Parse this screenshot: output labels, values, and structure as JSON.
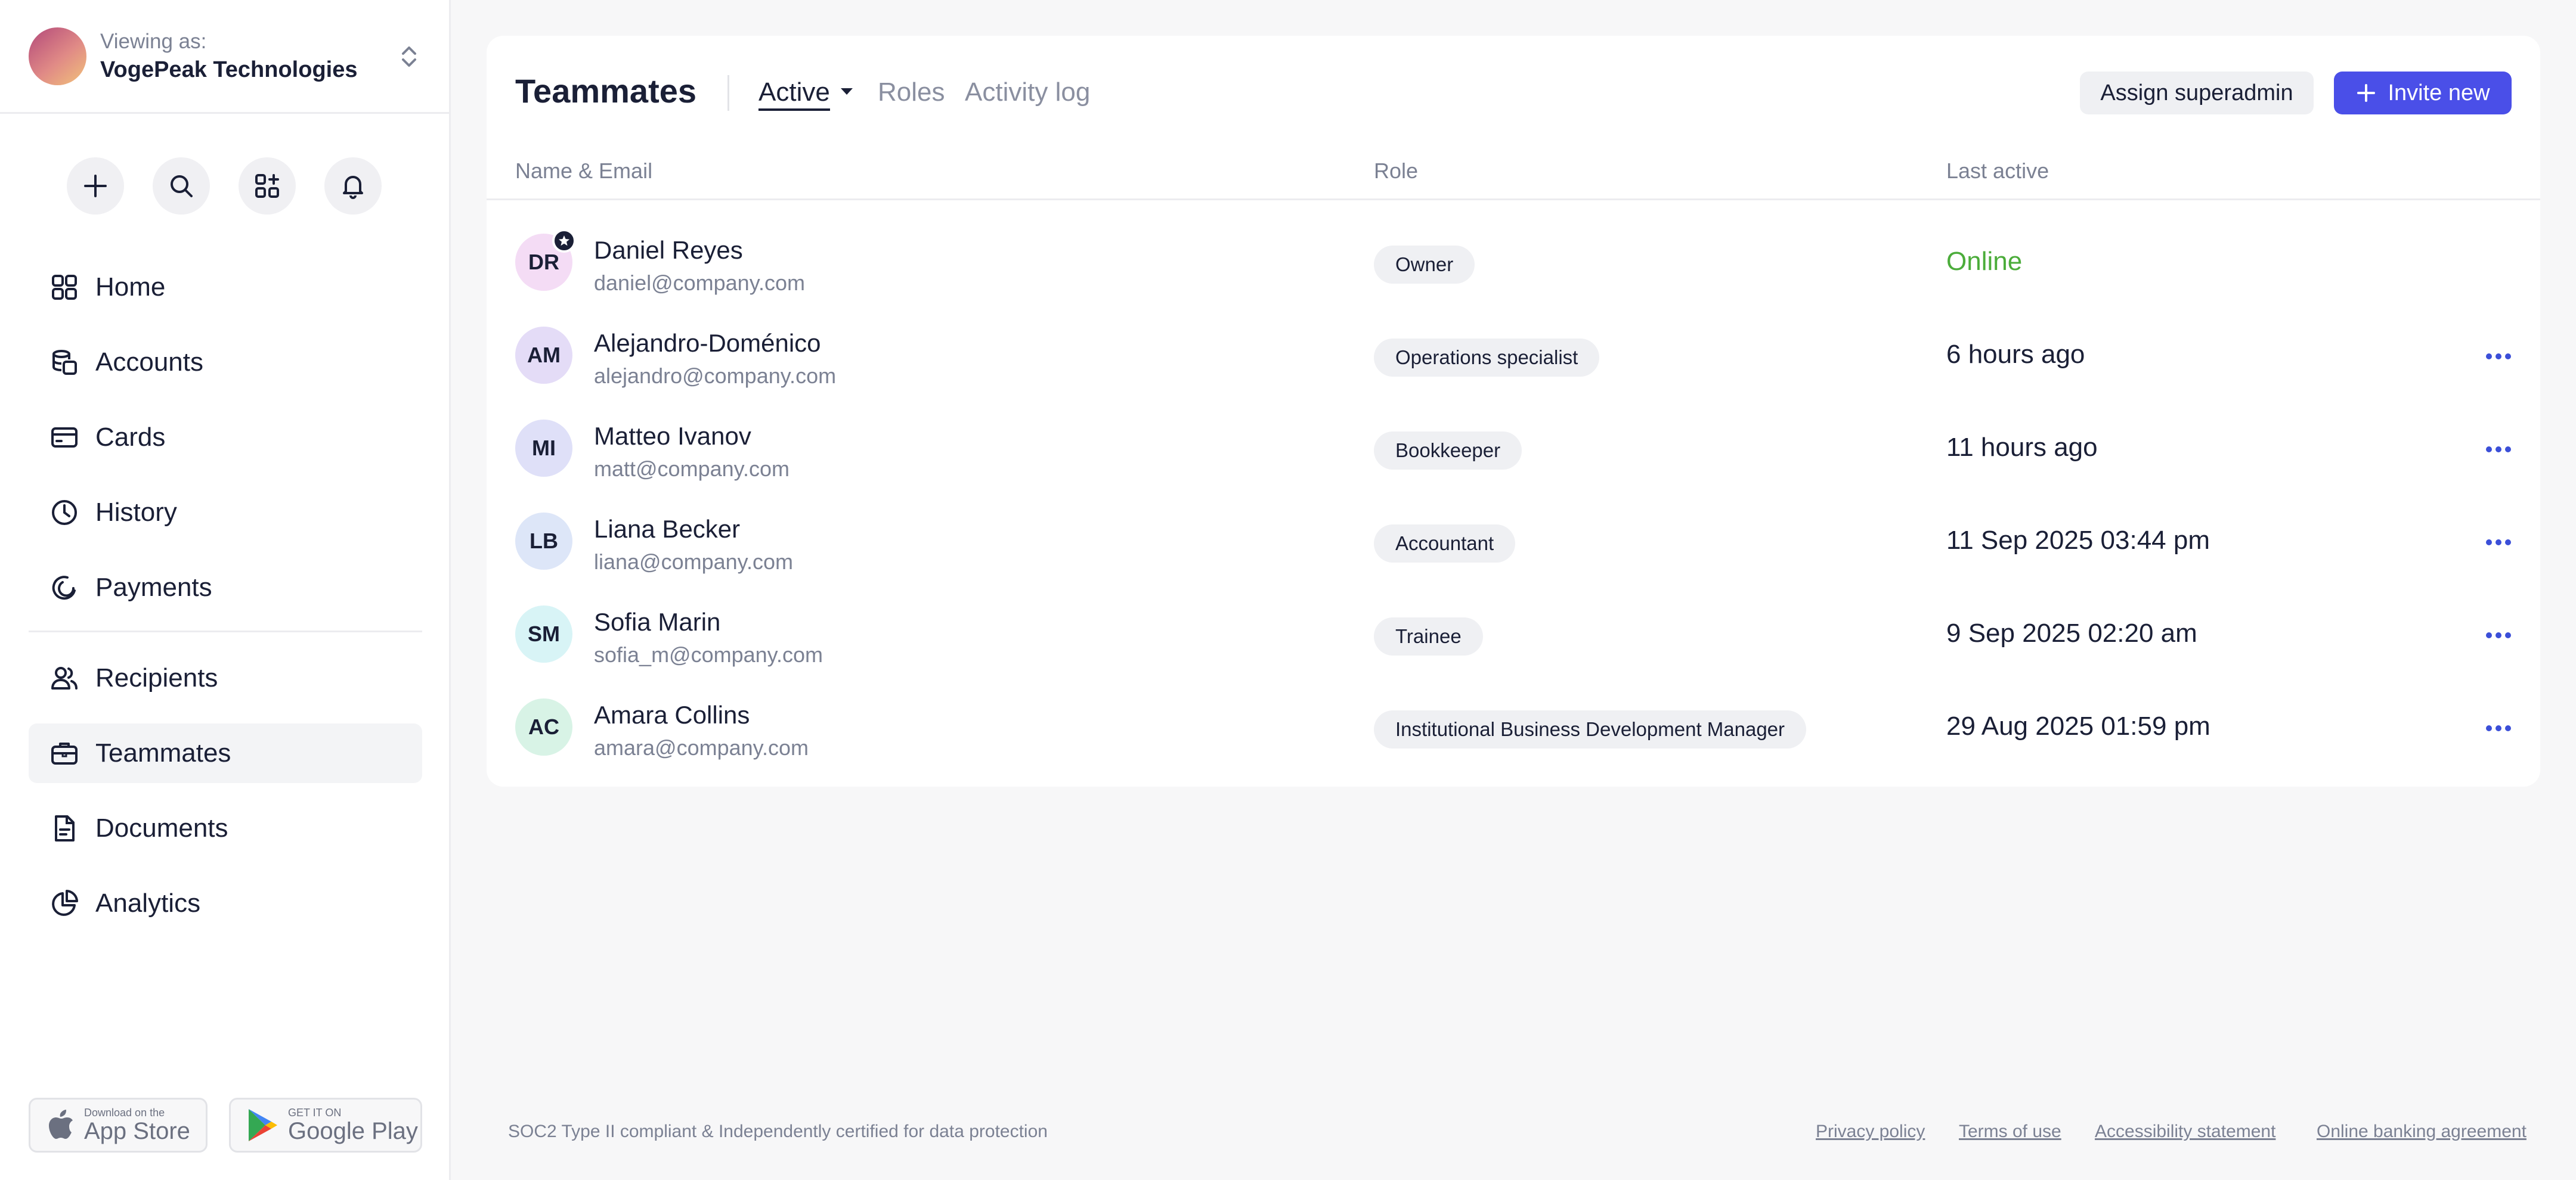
{
  "account": {
    "viewing_label": "Viewing as:",
    "company": "VogePeak Technologies"
  },
  "quick_actions": [
    "add-icon",
    "search-icon",
    "apps-icon",
    "bell-icon"
  ],
  "nav": {
    "items": [
      {
        "label": "Home",
        "icon": "home-grid-icon"
      },
      {
        "label": "Accounts",
        "icon": "coins-icon"
      },
      {
        "label": "Cards",
        "icon": "card-icon"
      },
      {
        "label": "History",
        "icon": "clock-icon"
      },
      {
        "label": "Payments",
        "icon": "payments-icon"
      },
      {
        "label": "Recipients",
        "icon": "users-icon"
      },
      {
        "label": "Teammates",
        "icon": "briefcase-icon",
        "active": true
      },
      {
        "label": "Documents",
        "icon": "document-icon"
      },
      {
        "label": "Analytics",
        "icon": "pie-chart-icon"
      }
    ]
  },
  "stores": {
    "apple_small": "Download on the",
    "apple_big": "App Store",
    "google_small": "GET IT ON",
    "google_big": "Google Play"
  },
  "header": {
    "title": "Teammates",
    "tabs": [
      "Active",
      "Roles",
      "Activity log"
    ],
    "assign_button": "Assign superadmin",
    "invite_button": "Invite new"
  },
  "table": {
    "columns": [
      "Name & Email",
      "Role",
      "Last active"
    ],
    "rows": [
      {
        "initials": "DR",
        "name": "Daniel Reyes",
        "email": "daniel@company.com",
        "role": "Owner",
        "last_active": "Online"
      },
      {
        "initials": "AM",
        "name": "Alejandro-Doménico",
        "email": "alejandro@company.com",
        "role": "Operations specialist",
        "last_active": "6 hours ago"
      },
      {
        "initials": "MI",
        "name": "Matteo Ivanov",
        "email": "matt@company.com",
        "role": "Bookkeeper",
        "last_active": "11 hours ago"
      },
      {
        "initials": "LB",
        "name": "Liana Becker",
        "email": "liana@company.com",
        "role": "Accountant",
        "last_active": "11 Sep 2025 03:44 pm"
      },
      {
        "initials": "SM",
        "name": "Sofia Marin",
        "email": "sofia_m@company.com",
        "role": "Trainee",
        "last_active": "9 Sep 2025 02:20 am"
      },
      {
        "initials": "AC",
        "name": "Amara Collins",
        "email": "amara@company.com",
        "role": "Institutional Business Development Manager",
        "last_active": "29 Aug 2025 01:59 pm"
      }
    ]
  },
  "footer": {
    "compliance": "SOC2 Type II compliant & Independently certified for data protection",
    "links": [
      "Privacy policy",
      "Terms of use",
      "Accessibility statement",
      "Online banking agreement"
    ]
  },
  "colors": {
    "accent": "#4a4fe8",
    "online": "#4bac3a",
    "text": "#1a1f36",
    "muted": "#7b8193"
  }
}
